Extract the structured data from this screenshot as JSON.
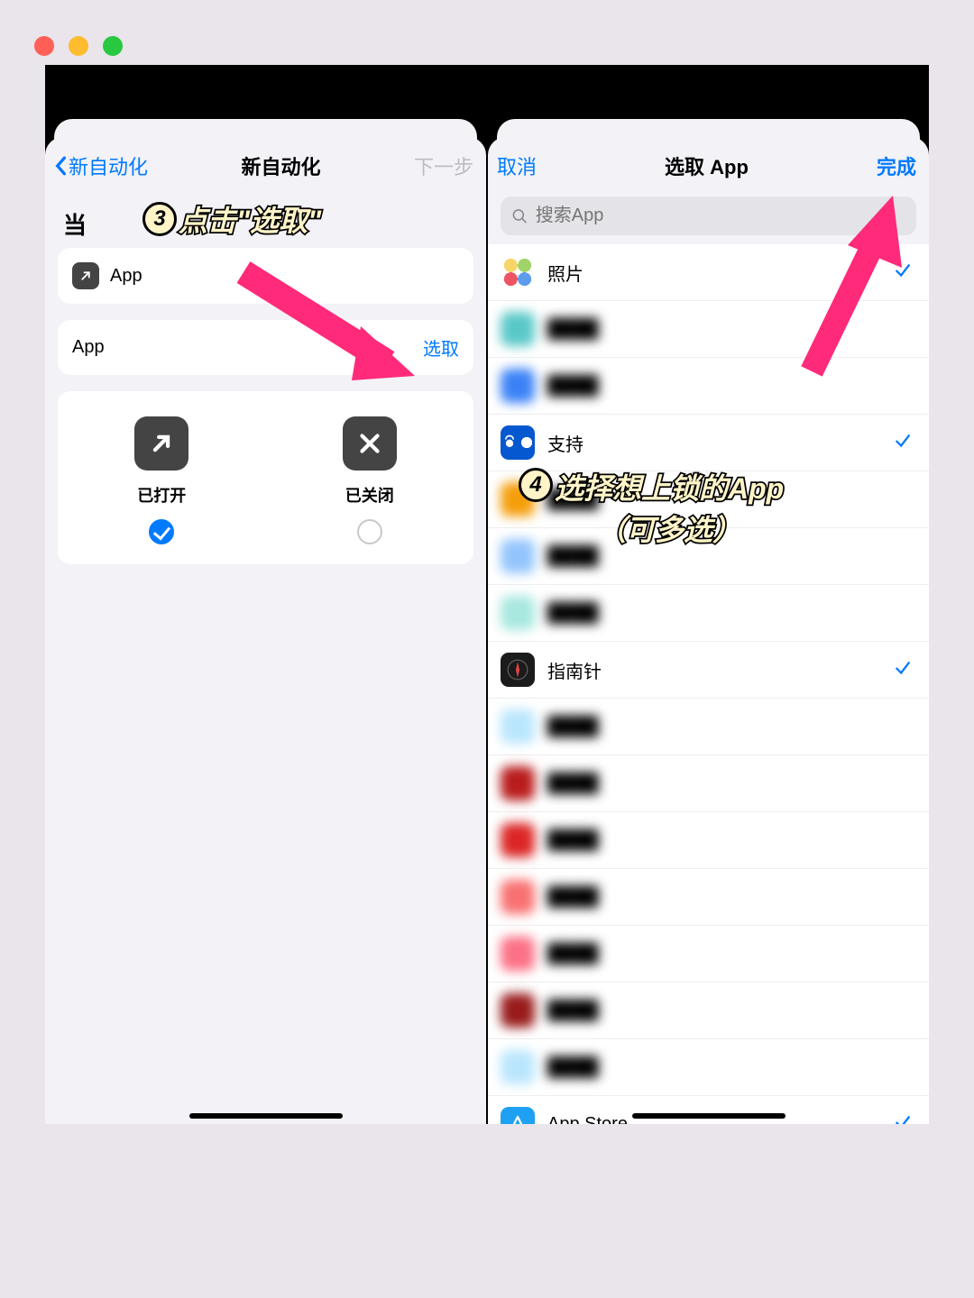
{
  "colors": {
    "accent": "#007aff",
    "annot_fill": "#fff4c8",
    "arrow": "#ff2a7a"
  },
  "left": {
    "nav_back": "新自动化",
    "title": "新自动化",
    "nav_next": "下一步",
    "when_label": "当",
    "app_row_label": "App",
    "select_row_label": "App",
    "select_button": "选取",
    "choices": {
      "opened": {
        "label": "已打开",
        "selected": true
      },
      "closed": {
        "label": "已关闭",
        "selected": false
      }
    },
    "annotation": {
      "num": "3",
      "text": "点击\"选取\""
    }
  },
  "right": {
    "nav_cancel": "取消",
    "title": "选取 App",
    "nav_done": "完成",
    "search_placeholder": "搜索App",
    "apps": [
      {
        "name": "照片",
        "checked": true,
        "blurred": false,
        "iconClass": "photos-ico"
      },
      {
        "name": "████",
        "checked": false,
        "blurred": true,
        "iconClass": "c-teal"
      },
      {
        "name": "████",
        "checked": false,
        "blurred": true,
        "iconClass": "c-blue"
      },
      {
        "name": "支持",
        "checked": true,
        "blurred": false,
        "iconClass": "support-ico"
      },
      {
        "name": "████",
        "checked": false,
        "blurred": true,
        "iconClass": "c-orange"
      },
      {
        "name": "████",
        "checked": false,
        "blurred": true,
        "iconClass": "c-lblue"
      },
      {
        "name": "████",
        "checked": false,
        "blurred": true,
        "iconClass": "c-teal2"
      },
      {
        "name": "指南针",
        "checked": true,
        "blurred": false,
        "iconClass": "compass-ico"
      },
      {
        "name": "████",
        "checked": false,
        "blurred": true,
        "iconClass": "c-sky"
      },
      {
        "name": "████",
        "checked": false,
        "blurred": true,
        "iconClass": "c-red"
      },
      {
        "name": "████",
        "checked": false,
        "blurred": true,
        "iconClass": "c-crim"
      },
      {
        "name": "████",
        "checked": false,
        "blurred": true,
        "iconClass": "c-orange2"
      },
      {
        "name": "████",
        "checked": false,
        "blurred": true,
        "iconClass": "c-pink"
      },
      {
        "name": "████",
        "checked": false,
        "blurred": true,
        "iconClass": "c-red2"
      },
      {
        "name": "████",
        "checked": false,
        "blurred": true,
        "iconClass": "c-sky"
      },
      {
        "name": "App Store",
        "checked": true,
        "blurred": false,
        "iconClass": "store-ico"
      }
    ],
    "annotation": {
      "num": "4",
      "line1": "选择想上锁的App",
      "line2": "（可多选）"
    }
  }
}
